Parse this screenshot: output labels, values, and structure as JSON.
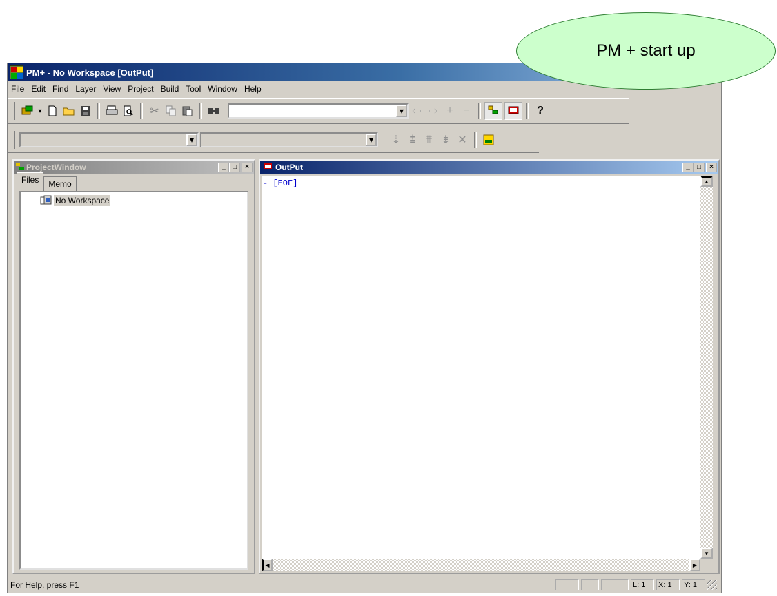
{
  "callout": {
    "text": "PM + start up"
  },
  "window": {
    "title": "PM+ - No Workspace  [OutPut]"
  },
  "menu": [
    "File",
    "Edit",
    "Find",
    "Layer",
    "View",
    "Project",
    "Build",
    "Tool",
    "Window",
    "Help"
  ],
  "project_window": {
    "title": "ProjectWindow",
    "tabs": [
      "Files",
      "Memo"
    ],
    "tree_root": "No Workspace"
  },
  "output_window": {
    "title": "OutPut",
    "lines": [
      "-  [EOF]"
    ]
  },
  "status": {
    "help_text": "For Help, press F1",
    "line": "L: 1",
    "x": "X: 1",
    "y": "Y: 1"
  },
  "colors": {
    "title_active": "#0a246a",
    "callout_fill": "#ccffcc",
    "eof_text": "#0000cc"
  }
}
